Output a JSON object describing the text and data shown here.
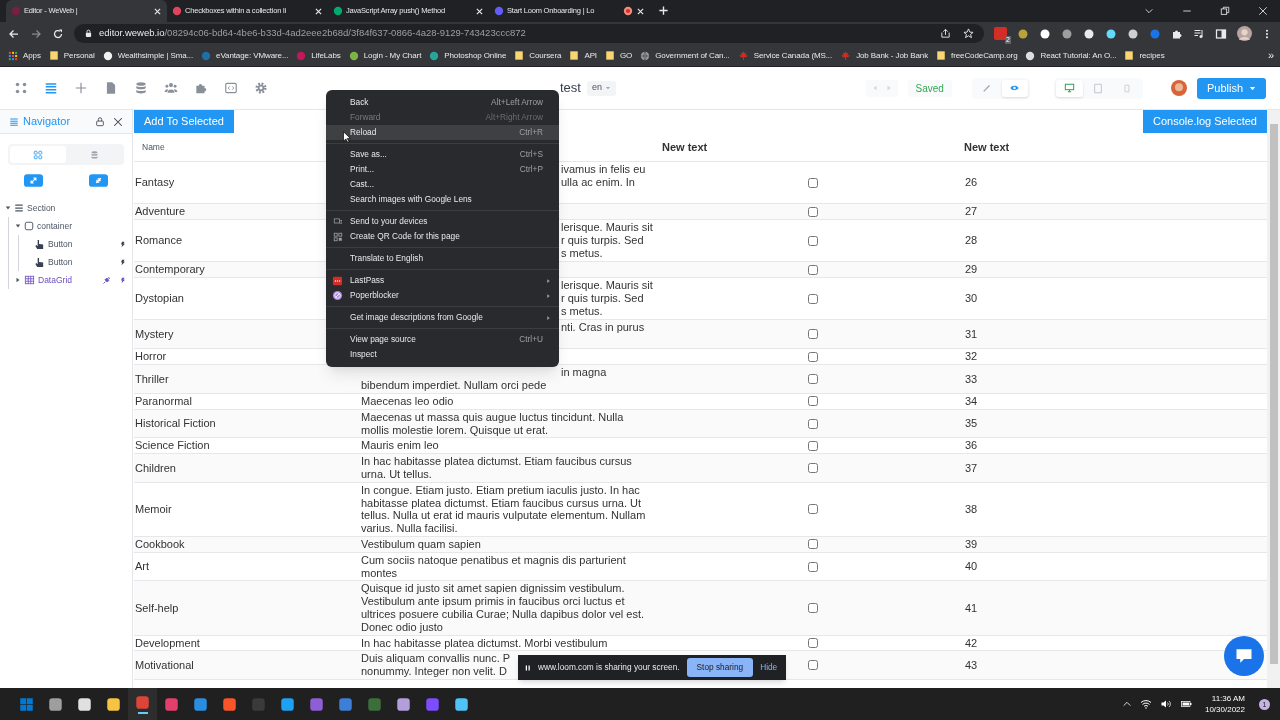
{
  "browser": {
    "tabs": [
      {
        "title": "Editor - WeWeb |",
        "selected": true,
        "color": "#7a1f3d"
      },
      {
        "title": "Checkboxes within a collection li",
        "selected": false,
        "color": "#e0435e"
      },
      {
        "title": "JavaScript Array push() Method",
        "selected": false,
        "color": "#04aa6d"
      },
      {
        "title": "Start Loom Onboarding | Lo",
        "selected": false,
        "color": "#625df5"
      }
    ],
    "address": {
      "host": "editor.weweb.io",
      "path": "/08294c06-bd64-4be6-b33d-4ad2eee2b68d/3f84f637-0866-4a28-9129-743423ccc872"
    },
    "extension_badge": "2",
    "bookmarks": [
      {
        "label": "Apps",
        "kind": "apps"
      },
      {
        "label": "Personal",
        "kind": "folder"
      },
      {
        "label": "Wealthsimple | Sma...",
        "kind": "site",
        "color": "#f1f1f1"
      },
      {
        "label": "eVantage: VMware...",
        "kind": "site",
        "color": "#1d6fa5"
      },
      {
        "label": "LifeLabs",
        "kind": "site",
        "color": "#c2185b"
      },
      {
        "label": "Login - My Chart",
        "kind": "site",
        "color": "#7cb342"
      },
      {
        "label": "Photoshop Online",
        "kind": "site",
        "color": "#26a69a"
      },
      {
        "label": "Coursera",
        "kind": "folder"
      },
      {
        "label": "API",
        "kind": "folder"
      },
      {
        "label": "GO",
        "kind": "folder"
      },
      {
        "label": "Government of Can...",
        "kind": "globe"
      },
      {
        "label": "Service Canada (MS...",
        "kind": "maple"
      },
      {
        "label": "Job Bank - Job Bank",
        "kind": "maple"
      },
      {
        "label": "freeCodeCamp.org",
        "kind": "folder"
      },
      {
        "label": "React Tutorial: An O...",
        "kind": "site",
        "color": "#dddddd"
      },
      {
        "label": "recipes",
        "kind": "folder"
      }
    ],
    "more_bookmarks": "»"
  },
  "editor": {
    "page": "test",
    "language": "en",
    "status": "Saved",
    "publish": "Publish",
    "modes": [
      {
        "kind": "edit",
        "selected": false
      },
      {
        "kind": "preview",
        "selected": true
      }
    ],
    "devices": [
      {
        "kind": "desktop",
        "selected": true
      },
      {
        "kind": "tablet",
        "selected": false
      },
      {
        "kind": "mobile",
        "selected": false
      }
    ]
  },
  "navigator": {
    "title": "Navigator",
    "tabs": [
      {
        "kind": "layout",
        "selected": true
      },
      {
        "kind": "data",
        "selected": false
      }
    ],
    "tree": [
      {
        "label": "Section",
        "kind": "section",
        "expanded": true,
        "children": [
          {
            "label": "container",
            "kind": "container",
            "expanded": true,
            "children": [
              {
                "label": "Button",
                "kind": "button"
              },
              {
                "label": "Button",
                "kind": "button"
              }
            ]
          },
          {
            "label": "DataGrid",
            "kind": "datagrid",
            "expanded": false
          }
        ]
      }
    ]
  },
  "canvas": {
    "add_button": "Add To Selected",
    "console_button": "Console.log Selected",
    "table": {
      "name_header": "Name",
      "column_3_header": "New text",
      "column_4_header": "New text",
      "rows": [
        {
          "name": "Fantasy",
          "description": "ivamus in felis eu\nulla ac enim. In",
          "checked": false,
          "number": "26"
        },
        {
          "name": "Adventure",
          "checked": false,
          "number": "27"
        },
        {
          "name": "Romance",
          "description": "lerisque. Mauris sit\nr quis turpis. Sed\ns metus.",
          "checked": false,
          "number": "28"
        },
        {
          "name": "Contemporary",
          "checked": false,
          "number": "29"
        },
        {
          "name": "Dystopian",
          "description": "lerisque. Mauris sit\nr quis turpis. Sed\ns metus.",
          "checked": false,
          "number": "30"
        },
        {
          "name": "Mystery",
          "description": "nti. Cras in purus",
          "checked": false,
          "number": "31"
        },
        {
          "name": "Horror",
          "checked": false,
          "number": "32"
        },
        {
          "name": "Thriller",
          "description": "in magna",
          "description_continued": "bibendum imperdiet. Nullam orci pede",
          "checked": false,
          "number": "33"
        },
        {
          "name": "Paranormal",
          "description": "Maecenas leo odio",
          "checked": false,
          "number": "34"
        },
        {
          "name": "Historical Fiction",
          "description": "Maecenas ut massa quis augue luctus tincidunt. Nulla\nmollis molestie lorem. Quisque ut erat.",
          "checked": false,
          "number": "35"
        },
        {
          "name": "Science Fiction",
          "description": "Mauris enim leo",
          "checked": false,
          "number": "36"
        },
        {
          "name": "Children",
          "description": "In hac habitasse platea dictumst. Etiam faucibus cursus\nurna. Ut tellus.",
          "checked": false,
          "number": "37"
        },
        {
          "name": "Memoir",
          "description": "In congue. Etiam justo. Etiam pretium iaculis justo. In hac\nhabitasse platea dictumst. Etiam faucibus cursus urna. Ut\ntellus. Nulla ut erat id mauris vulputate elementum. Nullam\nvarius. Nulla facilisi.",
          "checked": false,
          "number": "38"
        },
        {
          "name": "Cookbook",
          "description": "Vestibulum quam sapien",
          "checked": false,
          "number": "39"
        },
        {
          "name": "Art",
          "description": "Cum sociis natoque penatibus et magnis dis parturient\nmontes",
          "checked": false,
          "number": "40"
        },
        {
          "name": "Self-help",
          "description": "Quisque id justo sit amet sapien dignissim vestibulum.\nVestibulum ante ipsum primis in faucibus orci luctus et\nultrices posuere cubilia Curae; Nulla dapibus dolor vel est.\nDonec odio justo",
          "checked": false,
          "number": "41"
        },
        {
          "name": "Development",
          "description": "In hac habitasse platea dictumst. Morbi vestibulum",
          "checked": false,
          "number": "42"
        },
        {
          "name": "Motivational",
          "description": "Duis aliquam convallis nunc. P\nnonummy. Integer non velit. D",
          "checked": false,
          "number": "43"
        }
      ]
    }
  },
  "context_menu": [
    [
      {
        "label": "Back",
        "shortcut": "Alt+Left Arrow",
        "disabled": false,
        "selected": false
      },
      {
        "label": "Forward",
        "shortcut": "Alt+Right Arrow",
        "disabled": true,
        "selected": false
      },
      {
        "label": "Reload",
        "shortcut": "Ctrl+R",
        "disabled": false,
        "selected": true
      }
    ],
    [
      {
        "label": "Save as...",
        "shortcut": "Ctrl+S",
        "disabled": false,
        "selected": false
      },
      {
        "label": "Print...",
        "shortcut": "Ctrl+P",
        "disabled": false,
        "selected": false
      },
      {
        "label": "Cast...",
        "disabled": false,
        "selected": false
      },
      {
        "label": "Search images with Google Lens",
        "disabled": false,
        "selected": false
      }
    ],
    [
      {
        "label": "Send to your devices",
        "kind": "devices",
        "disabled": false,
        "selected": false
      },
      {
        "label": "Create QR Code for this page",
        "kind": "qr",
        "disabled": false,
        "selected": false
      }
    ],
    [
      {
        "label": "Translate to English",
        "disabled": false,
        "selected": false
      }
    ],
    [
      {
        "label": "LastPass",
        "kind": "lastpass",
        "submenu": true,
        "disabled": false,
        "selected": false
      },
      {
        "label": "Poperblocker",
        "kind": "blocker",
        "submenu": true,
        "disabled": false,
        "selected": false
      }
    ],
    [
      {
        "label": "Get image descriptions from Google",
        "submenu": true,
        "disabled": false,
        "selected": false
      }
    ],
    [
      {
        "label": "View page source",
        "shortcut": "Ctrl+U",
        "disabled": false,
        "selected": false
      },
      {
        "label": "Inspect",
        "disabled": false,
        "selected": false
      }
    ]
  ],
  "screen_share": {
    "message": "www.loom.com is sharing your screen.",
    "stop": "Stop sharing",
    "hide": "Hide"
  },
  "taskbar": {
    "apps": [
      {
        "kind": "windows",
        "selected": false
      },
      {
        "kind": "files",
        "selected": false
      },
      {
        "kind": "alien",
        "selected": false
      },
      {
        "kind": "folder",
        "selected": false
      },
      {
        "kind": "chrome",
        "selected": true
      },
      {
        "kind": "ide",
        "selected": false
      },
      {
        "kind": "vscode",
        "selected": false
      },
      {
        "kind": "brave",
        "selected": false
      },
      {
        "kind": "terminal",
        "selected": false
      },
      {
        "kind": "bird",
        "selected": false
      },
      {
        "kind": "studio",
        "selected": false
      },
      {
        "kind": "diagram",
        "selected": false
      },
      {
        "kind": "hs",
        "selected": false
      },
      {
        "kind": "pill",
        "selected": false
      },
      {
        "kind": "slack",
        "selected": false
      },
      {
        "kind": "nodes",
        "selected": false
      }
    ],
    "time": "11:36 AM",
    "date": "10/30/2022",
    "notifications": "1"
  }
}
